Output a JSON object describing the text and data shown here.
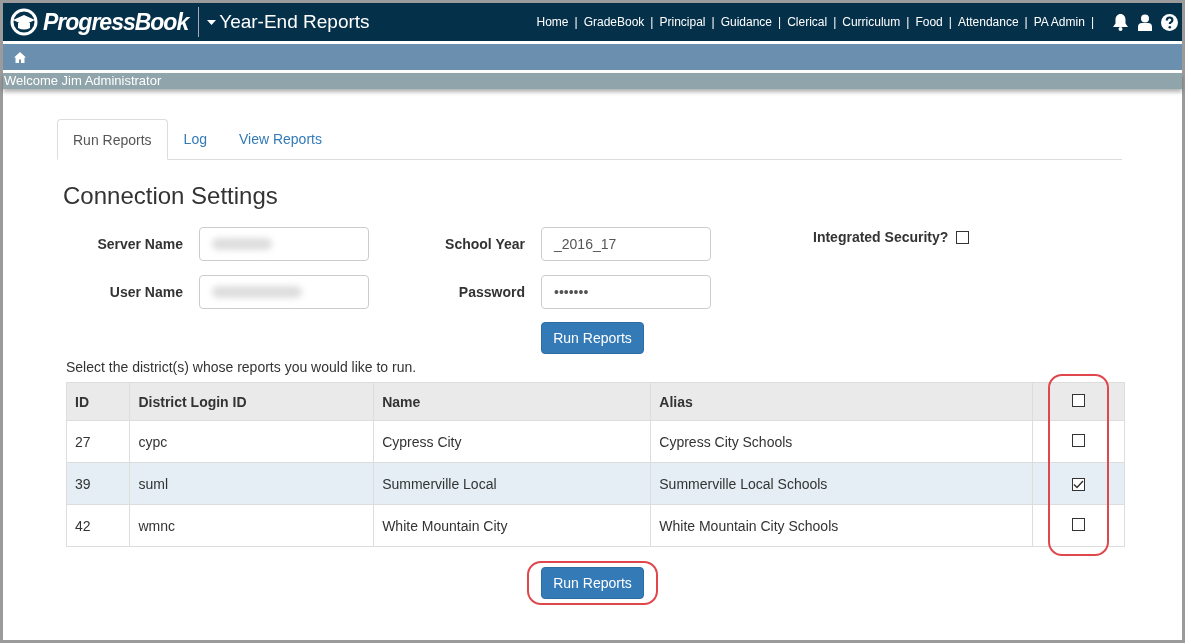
{
  "header": {
    "brand": "ProgressBook",
    "app_title": "Year-End Reports",
    "nav": [
      {
        "label": "Home",
        "separator": "|"
      },
      {
        "label": "GradeBook",
        "separator": "|"
      },
      {
        "label": "Principal",
        "separator": "|"
      },
      {
        "label": "Guidance",
        "separator": "|"
      },
      {
        "label": "Clerical",
        "separator": "|"
      },
      {
        "label": "Curriculum",
        "separator": "|"
      },
      {
        "label": "Food",
        "separator": "|"
      },
      {
        "label": "Attendance",
        "separator": "|"
      },
      {
        "label": "PA Admin",
        "separator": "|"
      }
    ]
  },
  "welcome": "Welcome Jim Administrator",
  "tabs": [
    {
      "label": "Run Reports",
      "selected": true
    },
    {
      "label": "Log",
      "selected": false
    },
    {
      "label": "View Reports",
      "selected": false
    }
  ],
  "section_title": "Connection Settings",
  "fields": [
    {
      "label": "Server Name",
      "kind": "redacted"
    },
    {
      "label": "School Year",
      "kind": "text",
      "value": "_2016_17"
    },
    {
      "label": "User Name",
      "kind": "redacted"
    },
    {
      "label": "Password",
      "kind": "text",
      "value": "•••••••"
    }
  ],
  "integrated_security": {
    "label": "Integrated Security?",
    "checked": false
  },
  "run_button": {
    "label": "Run Reports",
    "highlighted": false
  },
  "instruction": "Select the district(s) whose reports you would like to run.",
  "table": {
    "columns": [
      "ID",
      "District Login ID",
      "Name",
      "Alias"
    ],
    "select_all": {
      "checked": false
    },
    "checkbox_column_highlighted": true,
    "rows": [
      {
        "cells": [
          "27",
          "cypc",
          "Cypress City",
          "Cypress City Schools"
        ],
        "checked": false,
        "selected": false
      },
      {
        "cells": [
          "39",
          "suml",
          "Summerville Local",
          "Summerville Local Schools"
        ],
        "checked": true,
        "selected": true
      },
      {
        "cells": [
          "42",
          "wmnc",
          "White Mountain City",
          "White Mountain City Schools"
        ],
        "checked": false,
        "selected": false
      }
    ]
  },
  "bottom_button": {
    "label": "Run Reports",
    "highlighted": true
  }
}
